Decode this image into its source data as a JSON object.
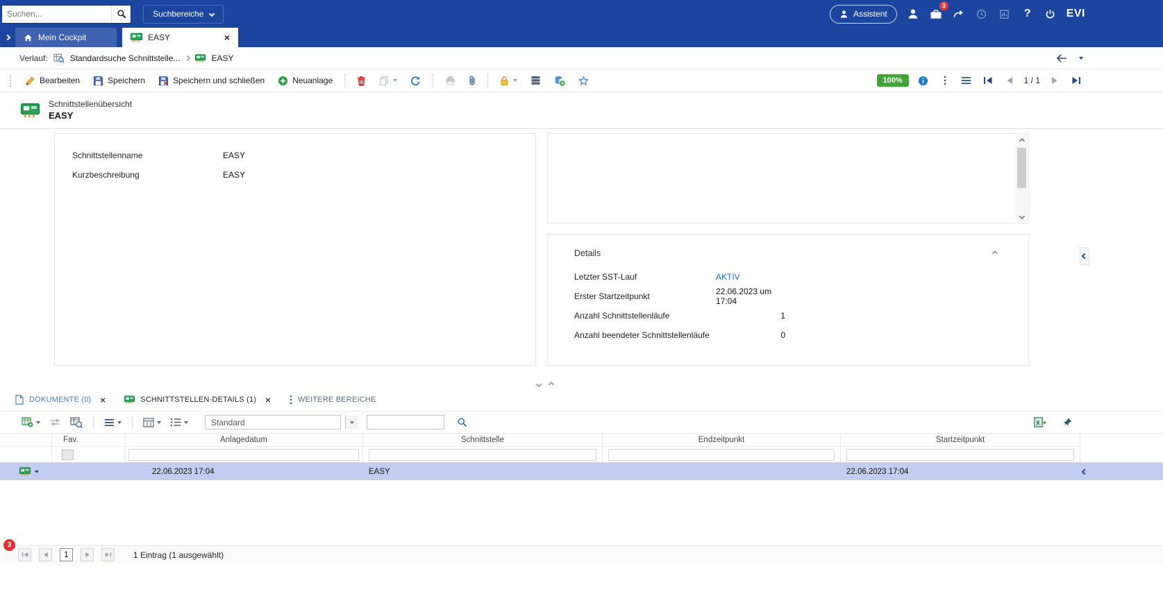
{
  "colors": {
    "topbar_blue": "#1b459e",
    "active_tab_blue": "#3f63b0",
    "zoom_badge_green": "#3fa535",
    "link_blue": "#1b6ec2",
    "selected_row": "#c3cdf0",
    "notification_red": "#e23b3b"
  },
  "topbar": {
    "search_placeholder": "Suchen...",
    "search_areas": "Suchbereiche",
    "assistant": "Assistent",
    "inbox_badge": "3",
    "help": "?",
    "brand": "EVI"
  },
  "tabs": [
    {
      "label": "Mein Cockpit"
    },
    {
      "label": "EASY"
    }
  ],
  "breadcrumb": {
    "label": "Verlauf:",
    "item1": "Standardsuche Schnittstelle...",
    "item2": "EASY"
  },
  "toolbar": {
    "edit": "Bearbeiten",
    "save": "Speichern",
    "save_and_close": "Speichern und schließen",
    "create_new": "Neuanlage",
    "zoom": "100%",
    "page_indicator": "1 / 1"
  },
  "page_header": {
    "subtitle": "Schnittstellenübersicht",
    "title": "EASY"
  },
  "form_fields": [
    {
      "label": "Schnittstellenname",
      "value": "EASY"
    },
    {
      "label": "Kurzbeschreibung",
      "value": "EASY"
    }
  ],
  "details": {
    "title": "Details",
    "rows": [
      {
        "label": "Letzter SST-Lauf",
        "value": "AKTIV"
      },
      {
        "label": "Erster Startzeitpunkt",
        "value": "22.06.2023 um 17:04"
      },
      {
        "label": "Anzahl Schnittstellenläufe",
        "value": "1"
      },
      {
        "label": "Anzahl beendeter Schnittstellenläufe",
        "value": "0"
      }
    ]
  },
  "bottom_tabs": [
    {
      "label": "DOKUMENTE (0)"
    },
    {
      "label": "SCHNITTSTELLEN-DETAILS (1)"
    },
    {
      "label": "WEITERE BEREICHE"
    }
  ],
  "grid_toolbar": {
    "view_name": "Standard"
  },
  "table": {
    "columns": [
      "Fav.",
      "Anlagedatum",
      "Schnittstelle",
      "Endzeitpunkt",
      "Startzeitpunkt"
    ],
    "rows": [
      {
        "anlagedatum": "22.06.2023 17:04",
        "schnittstelle": "EASY",
        "endzeitpunkt": "",
        "startzeitpunkt": "22.06.2023 17:04"
      }
    ]
  },
  "pagination": {
    "current_page": "1",
    "summary": "1 Eintrag (1 ausgewählt)"
  },
  "notification_badge": "3"
}
